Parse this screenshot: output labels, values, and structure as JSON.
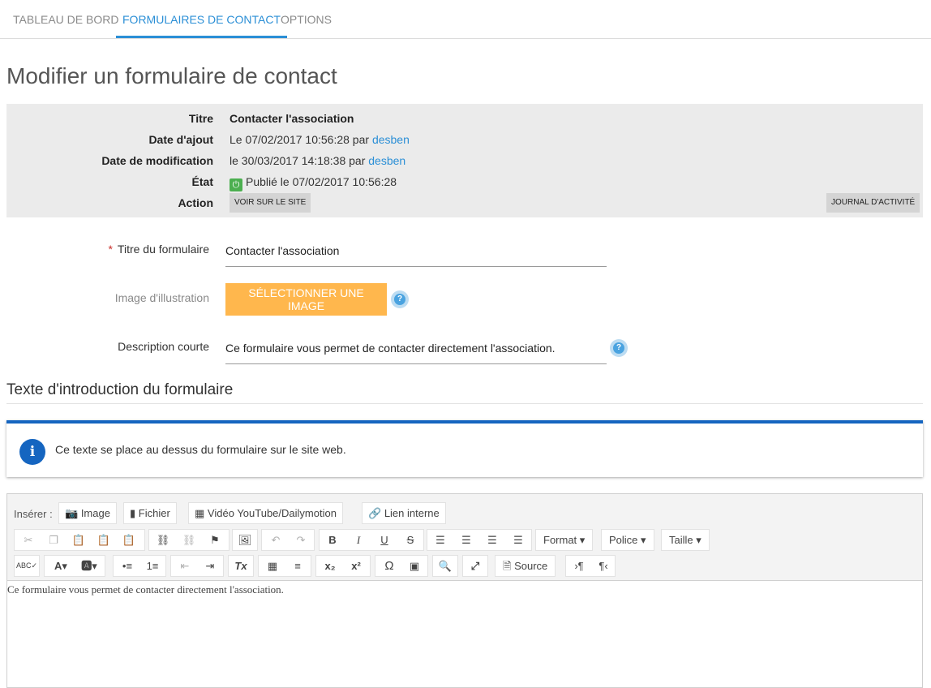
{
  "tabs": [
    "TABLEAU DE BORD",
    "FORMULAIRES DE CONTACT",
    "OPTIONS"
  ],
  "page_title": "Modifier un formulaire de contact",
  "info": {
    "titre_label": "Titre",
    "titre_value": "Contacter l'association",
    "date_ajout_label": "Date d'ajout",
    "date_ajout_value": "Le 07/02/2017 10:56:28 par",
    "date_ajout_user": "desben",
    "date_modif_label": "Date de modification",
    "date_modif_value": "le 30/03/2017 14:18:38 par",
    "date_modif_user": "desben",
    "etat_label": "État",
    "etat_value": "Publié le 07/02/2017 10:56:28",
    "action_label": "Action",
    "voir_label": "VOIR SUR LE SITE",
    "journal_label": "JOURNAL D'ACTIVITÉ"
  },
  "form": {
    "titre_label": "Titre du formulaire",
    "required_mark": "*",
    "titre_value": "Contacter l'association",
    "image_label": "Image d'illustration",
    "image_button": "SÉLECTIONNER UNE IMAGE",
    "description_label": "Description courte",
    "description_value": "Ce formulaire vous permet de contacter directement l'association."
  },
  "section_title": "Texte d'introduction du formulaire",
  "alert_text": "Ce texte se place au dessus du formulaire sur le site web.",
  "editor": {
    "insert_label": "Insérer :",
    "insert_buttons": [
      "Image",
      "Fichier",
      "Vidéo YouTube/Dailymotion",
      "Lien interne"
    ],
    "format_label": "Format",
    "police_label": "Police",
    "taille_label": "Taille",
    "source_label": "Source",
    "content": "Ce formulaire vous permet de contacter directement l'association."
  },
  "colors": {
    "accent": "#2b8fd6",
    "orange_button": "#ffb74d",
    "alert_blue": "#1565c0",
    "published_green": "#4caf50"
  }
}
